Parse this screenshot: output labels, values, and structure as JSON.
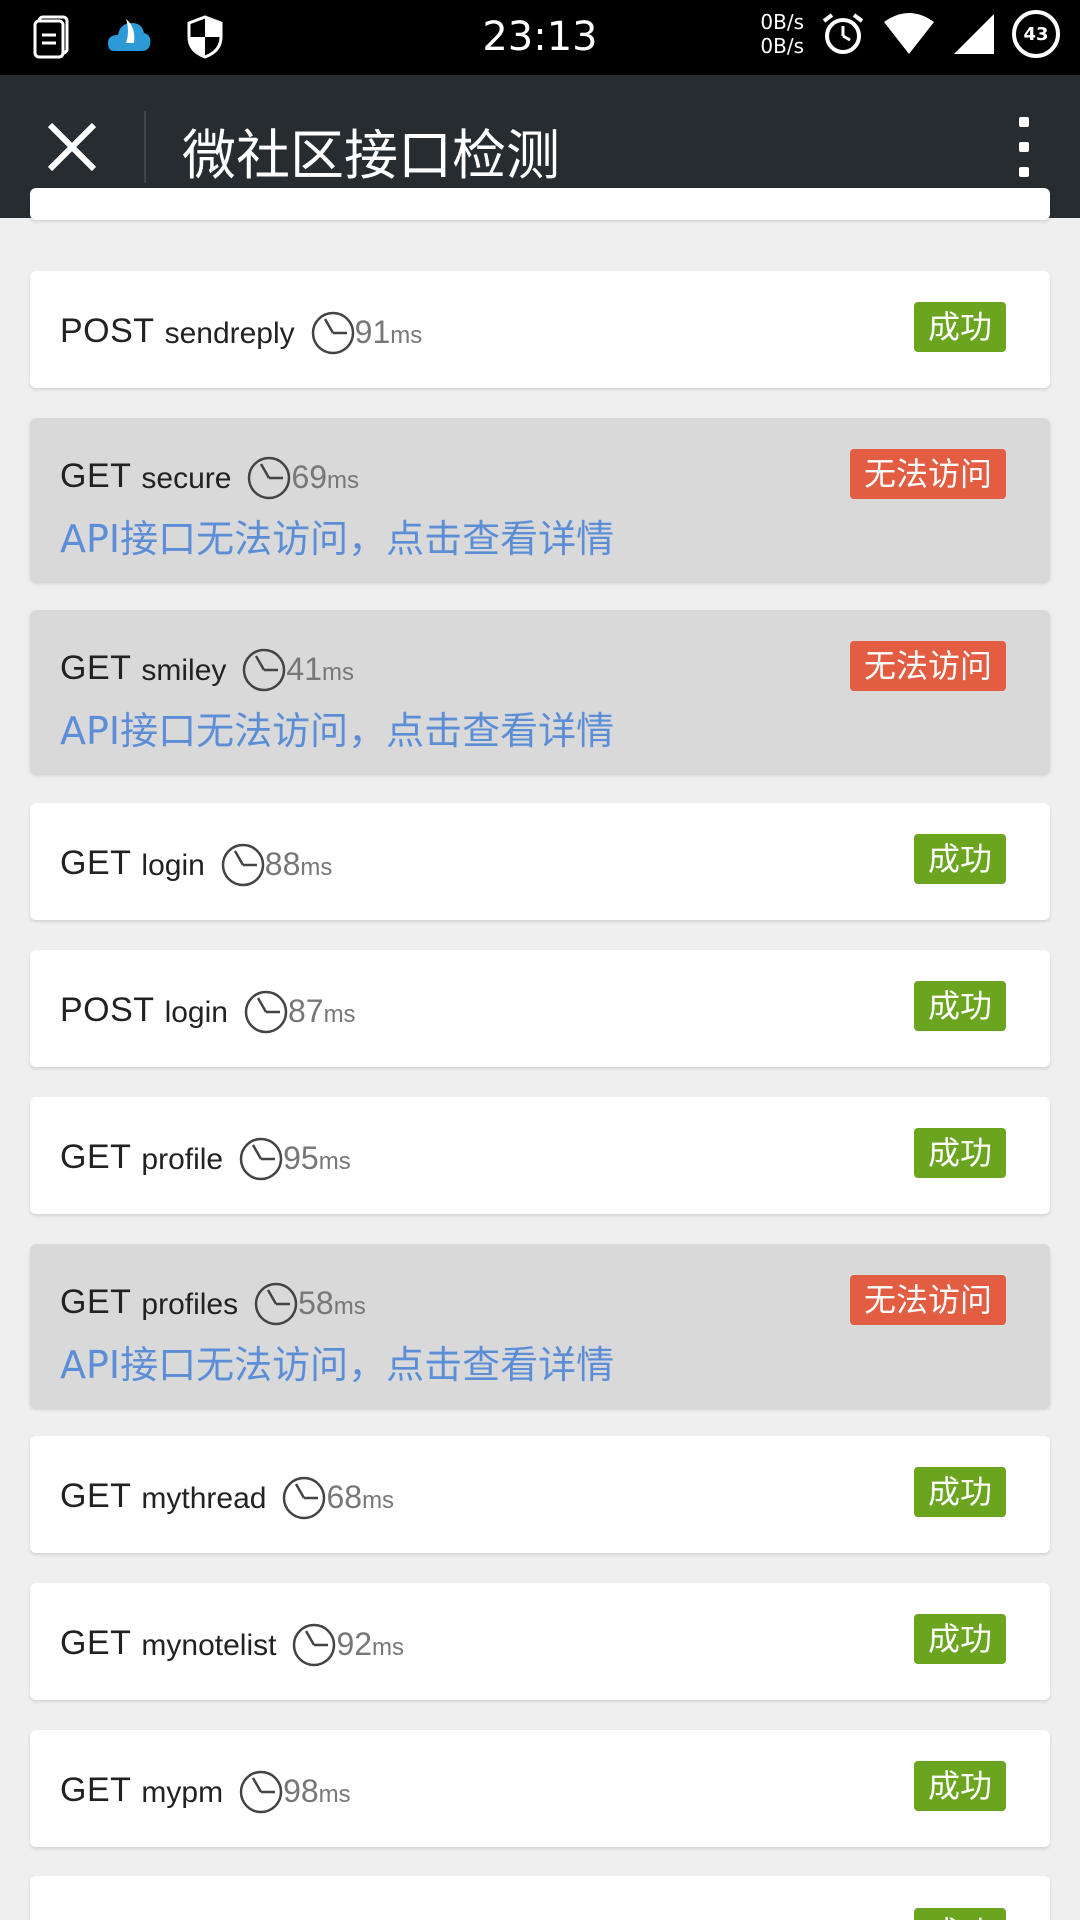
{
  "status_bar": {
    "time": "23:13",
    "net_up": "0B/s",
    "net_down": "0B/s",
    "battery": "43"
  },
  "app_bar": {
    "title": "微社区接口检测"
  },
  "hint_text": "API接口无法访问，点击查看详情",
  "badge_ok": "成功",
  "badge_fail": "无法访问",
  "unit": "ms",
  "items": [
    {
      "method": "POST",
      "endpoint": "sendreply",
      "time": "91",
      "status": "ok"
    },
    {
      "method": "GET",
      "endpoint": "secure",
      "time": "69",
      "status": "fail"
    },
    {
      "method": "GET",
      "endpoint": "smiley",
      "time": "41",
      "status": "fail"
    },
    {
      "method": "GET",
      "endpoint": "login",
      "time": "88",
      "status": "ok"
    },
    {
      "method": "POST",
      "endpoint": "login",
      "time": "87",
      "status": "ok"
    },
    {
      "method": "GET",
      "endpoint": "profile",
      "time": "95",
      "status": "ok"
    },
    {
      "method": "GET",
      "endpoint": "profiles",
      "time": "58",
      "status": "fail"
    },
    {
      "method": "GET",
      "endpoint": "mythread",
      "time": "68",
      "status": "ok"
    },
    {
      "method": "GET",
      "endpoint": "mynotelist",
      "time": "92",
      "status": "ok"
    },
    {
      "method": "GET",
      "endpoint": "mypm",
      "time": "98",
      "status": "ok"
    }
  ],
  "colors": {
    "success": "#6ba520",
    "fail": "#e35d43",
    "hint": "#5c8ed8",
    "appbar": "#262c30"
  }
}
